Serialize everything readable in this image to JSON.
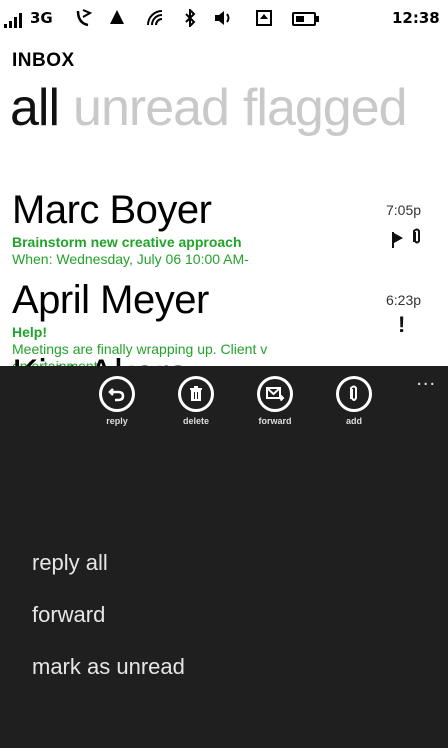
{
  "status_bar": {
    "network": "3G",
    "time": "12:38",
    "icons": [
      "signal-bars-icon",
      "data-3g-icon",
      "call-forwarding-icon",
      "triangle-icon",
      "wifi-icon",
      "bluetooth-icon",
      "sound-icon",
      "sync-icon",
      "battery-icon"
    ]
  },
  "header": {
    "section": "INBOX",
    "pivots": [
      "all",
      "unread",
      "flagged"
    ]
  },
  "messages": [
    {
      "sender": "Marc Boyer",
      "subject": "Brainstorm new creative approach",
      "preview": "When: Wednesday, July 06 10:00 AM-",
      "time": "7:05p",
      "indicators": [
        "flag-icon",
        "paperclip-icon"
      ]
    },
    {
      "sender": "April Meyer",
      "subject": "Help!",
      "preview": "Meetings are finally wrapping up.  Client v",
      "preview2": "entertainment",
      "time": "6:23p",
      "indicators": [
        "exclamation-icon"
      ]
    },
    {
      "sender": "Kim Akers"
    }
  ],
  "app_bar": {
    "more": "...",
    "buttons": [
      {
        "label": "reply",
        "icon": "reply-icon"
      },
      {
        "label": "delete",
        "icon": "trash-icon"
      },
      {
        "label": "forward",
        "icon": "forward-mail-icon"
      },
      {
        "label": "add",
        "icon": "paperclip-icon"
      }
    ],
    "menu": [
      "reply all",
      "forward",
      "mark as unread"
    ]
  },
  "colors": {
    "accent_green": "#22a32a",
    "appbar_bg": "#1f1f1f",
    "pivot_inactive": "#c9c9c9"
  }
}
